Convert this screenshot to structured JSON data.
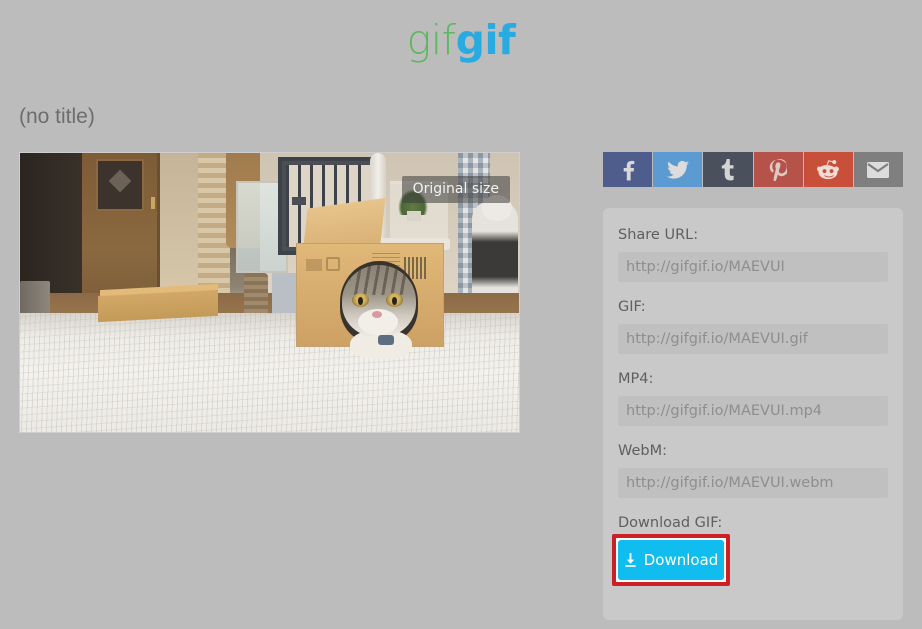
{
  "site": {
    "logo_part1": "gif",
    "logo_part2": "gif",
    "logo_color_1": "#5cb860",
    "logo_color_2": "#29abe2"
  },
  "title": "(no title)",
  "media": {
    "size_badge": "Original size",
    "alt": "Animated GIF of a tabby cat peeking out of a hole in a cardboard box on a white shag rug in a living room"
  },
  "share": {
    "buttons": [
      {
        "name": "facebook",
        "label": "Facebook",
        "icon": "facebook-icon",
        "color": "#4f5d8d"
      },
      {
        "name": "twitter",
        "label": "Twitter",
        "icon": "twitter-icon",
        "color": "#5b9bd1"
      },
      {
        "name": "tumblr",
        "label": "Tumblr",
        "icon": "tumblr-icon",
        "color": "#4a505c"
      },
      {
        "name": "pinterest",
        "label": "Pinterest",
        "icon": "pinterest-icon",
        "color": "#b5534a"
      },
      {
        "name": "reddit",
        "label": "Reddit",
        "icon": "reddit-icon",
        "color": "#c8503a"
      },
      {
        "name": "email",
        "label": "Email",
        "icon": "envelope-icon",
        "color": "#7f7f7f"
      }
    ]
  },
  "panel": {
    "fields": [
      {
        "label": "Share URL:",
        "value": "http://gifgif.io/MAEVUI"
      },
      {
        "label": "GIF:",
        "value": "http://gifgif.io/MAEVUI.gif"
      },
      {
        "label": "MP4:",
        "value": "http://gifgif.io/MAEVUI.mp4"
      },
      {
        "label": "WebM:",
        "value": "http://gifgif.io/MAEVUI.webm"
      }
    ],
    "download": {
      "label": "Download GIF:",
      "button_label": "Download",
      "button_color": "#11bcee",
      "icon": "download-icon",
      "highlight_color": "#cc1f26"
    }
  }
}
